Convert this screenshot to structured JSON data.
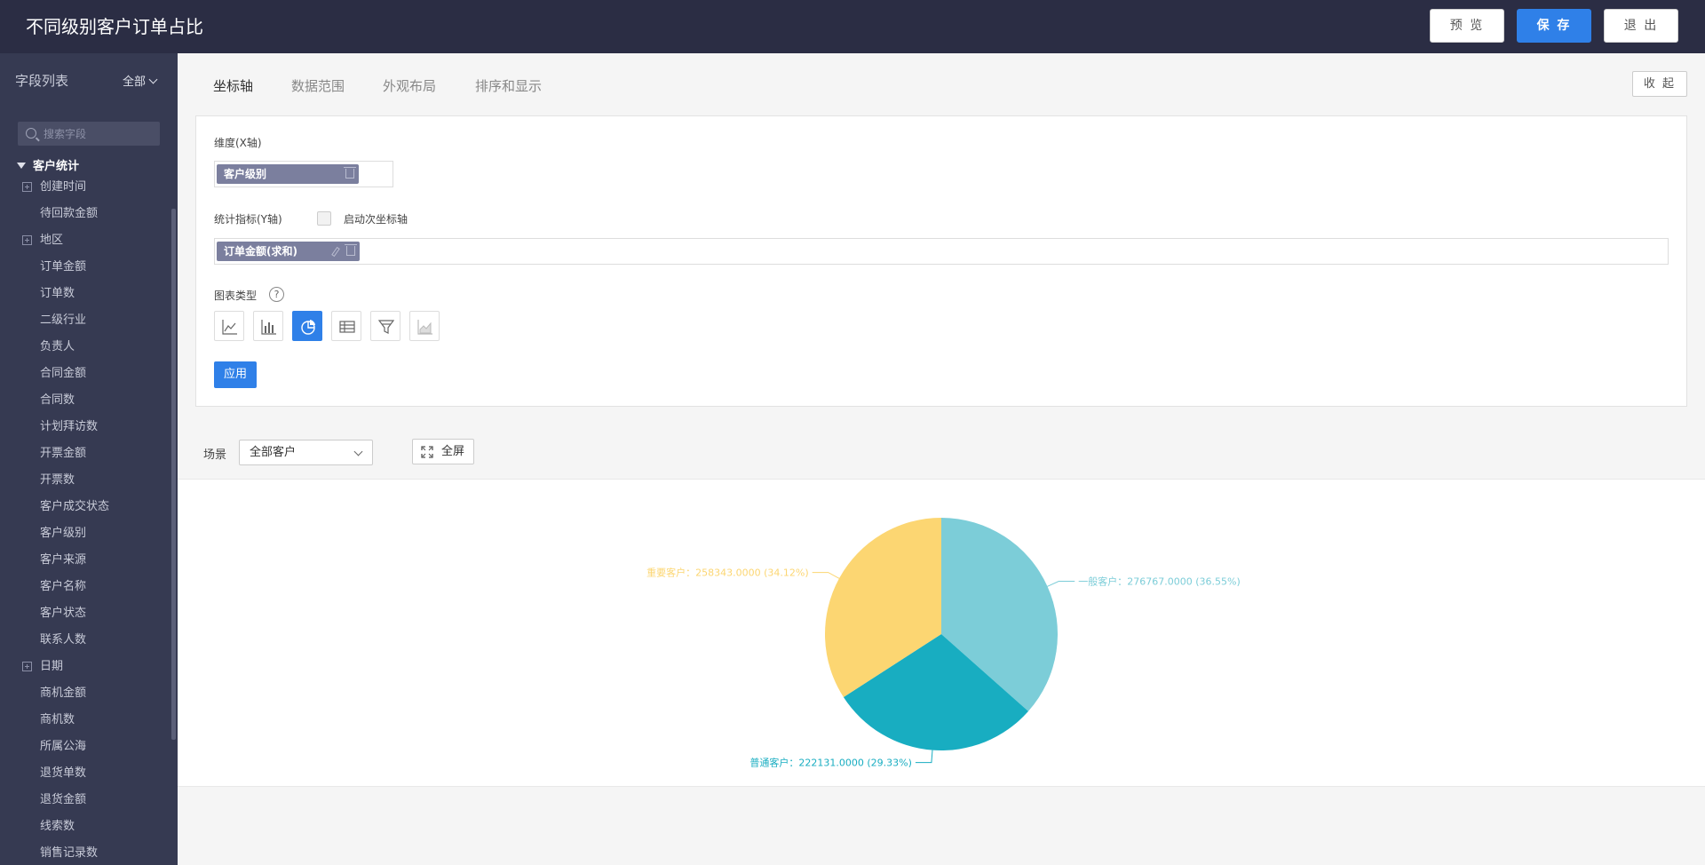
{
  "header": {
    "title": "不同级别客户订单占比",
    "preview_label": "预 览",
    "save_label": "保 存",
    "exit_label": "退 出"
  },
  "sidebar": {
    "title": "字段列表",
    "filter": "全部",
    "search_placeholder": "搜索字段",
    "group": "客户统计",
    "items": [
      {
        "label": "创建时间",
        "expandable": true
      },
      {
        "label": "待回款金额",
        "expandable": false
      },
      {
        "label": "地区",
        "expandable": true
      },
      {
        "label": "订单金额",
        "expandable": false
      },
      {
        "label": "订单数",
        "expandable": false
      },
      {
        "label": "二级行业",
        "expandable": false
      },
      {
        "label": "负责人",
        "expandable": false
      },
      {
        "label": "合同金额",
        "expandable": false
      },
      {
        "label": "合同数",
        "expandable": false
      },
      {
        "label": "计划拜访数",
        "expandable": false
      },
      {
        "label": "开票金额",
        "expandable": false
      },
      {
        "label": "开票数",
        "expandable": false
      },
      {
        "label": "客户成交状态",
        "expandable": false
      },
      {
        "label": "客户级别",
        "expandable": false
      },
      {
        "label": "客户来源",
        "expandable": false
      },
      {
        "label": "客户名称",
        "expandable": false
      },
      {
        "label": "客户状态",
        "expandable": false
      },
      {
        "label": "联系人数",
        "expandable": false
      },
      {
        "label": "日期",
        "expandable": true
      },
      {
        "label": "商机金额",
        "expandable": false
      },
      {
        "label": "商机数",
        "expandable": false
      },
      {
        "label": "所属公海",
        "expandable": false
      },
      {
        "label": "退货单数",
        "expandable": false
      },
      {
        "label": "退货金额",
        "expandable": false
      },
      {
        "label": "线索数",
        "expandable": false
      },
      {
        "label": "销售记录数",
        "expandable": false
      }
    ]
  },
  "tabs": [
    "坐标轴",
    "数据范围",
    "外观布局",
    "排序和显示"
  ],
  "collapse_label": "收 起",
  "config": {
    "dimension_label": "维度(X轴)",
    "dimension_chip": "客户级别",
    "metric_label": "统计指标(Y轴)",
    "secondary_axis_label": "启动次坐标轴",
    "metric_chip": "订单金额(求和)",
    "chart_type_label": "图表类型",
    "help_glyph": "?",
    "chart_types": [
      "line-chart-icon",
      "bar-chart-icon",
      "pie-chart-icon",
      "table-icon",
      "funnel-icon",
      "area-chart-icon"
    ],
    "selected_chart_type": "pie-chart-icon",
    "apply_label": "应用"
  },
  "scene": {
    "label": "场景",
    "value": "全部客户",
    "fullscreen_label": "全屏"
  },
  "chart_data": {
    "type": "pie",
    "slices": [
      {
        "name": "一般客户",
        "value": 276767.0,
        "percent": 36.55,
        "color": "#7ccdd8",
        "label": "一般客户：276767.0000 (36.55%)"
      },
      {
        "name": "普通客户",
        "value": 222131.0,
        "percent": 29.33,
        "color": "#18adc1",
        "label": "普通客户：222131.0000 (29.33%)"
      },
      {
        "name": "重要客户",
        "value": 258343.0,
        "percent": 34.12,
        "color": "#fcd672",
        "label": "重要客户：258343.0000 (34.12%)"
      }
    ]
  },
  "colors": {
    "header_bg": "#2b2d44",
    "sidebar_bg": "#363a52",
    "accent": "#2f80e8"
  }
}
